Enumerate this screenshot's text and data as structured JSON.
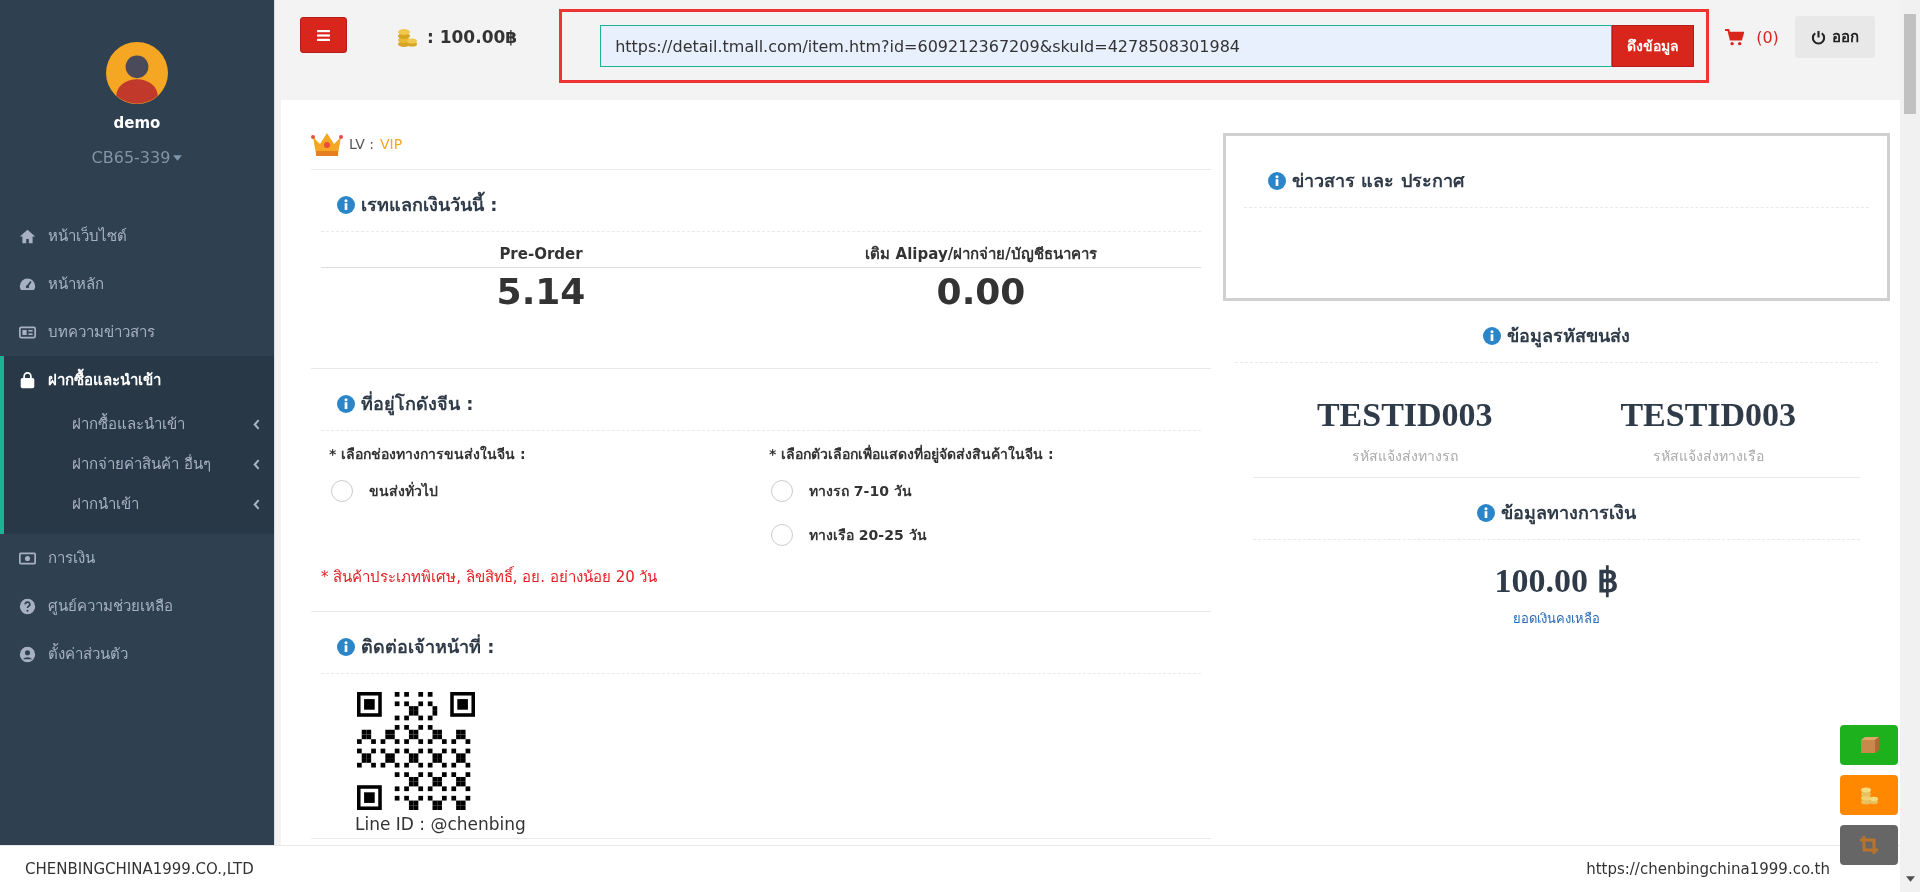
{
  "sidebar": {
    "user": {
      "name": "demo",
      "code": "CB65-339"
    },
    "items": [
      {
        "label": "หน้าเว็บไซต์",
        "selected": false
      },
      {
        "label": "หน้าหลัก",
        "selected": false
      },
      {
        "label": "บทความข่าวสาร",
        "selected": false
      },
      {
        "label": "ฝากซื้อและนำเข้า",
        "selected": true,
        "expanded": true,
        "children": [
          {
            "label": "ฝากซื้อและนำเข้า"
          },
          {
            "label": "ฝากจ่ายค่าสินค้า อื่นๆ"
          },
          {
            "label": "ฝากนำเข้า"
          }
        ]
      },
      {
        "label": "การเงิน",
        "selected": false
      },
      {
        "label": "ศูนย์ความช่วยเหลือ",
        "selected": false
      },
      {
        "label": "ตั้งค่าส่วนตัว",
        "selected": false
      }
    ]
  },
  "topbar": {
    "balance": ": 100.00฿",
    "url_field": {
      "value": "https://detail.tmall.com/item.htm?id=609212367209&skuId=4278508301984"
    },
    "fetch_button": "ดึงข้อมูล",
    "cart_count": "(0)",
    "logout_button": "ออก"
  },
  "level": {
    "label": "LV :",
    "value": "VIP"
  },
  "rates": {
    "title": "เรทแลกเงินวันนี้ :",
    "columns": [
      {
        "label": "Pre-Order",
        "value": "5.14"
      },
      {
        "label": "เติม Alipay/ฝากจ่าย/บัญชีธนาคาร",
        "value": "0.00"
      }
    ]
  },
  "warehouse": {
    "title": "ที่อยู่โกดังจีน :",
    "groups": [
      {
        "label": "* เลือกช่องทางการขนส่งในจีน :",
        "options": [
          {
            "label": "ขนส่งทั่วไป",
            "selected": false
          }
        ]
      },
      {
        "label": "* เลือกตัวเลือกเพื่อแสดงที่อยู่จัดส่งสินค้าในจีน :",
        "options": [
          {
            "label": "ทางรถ 7-10 วัน",
            "selected": false
          },
          {
            "label": "ทางเรือ 20-25 วัน",
            "selected": false
          }
        ]
      }
    ],
    "note": "* สินค้าประเภทพิเศษ, ลิขสิทธิ์, อย. อย่างน้อย 20 วัน"
  },
  "contact": {
    "title": "ติดต่อเจ้าหน้าที่ :",
    "line_id": "Line ID : @chenbing"
  },
  "news": {
    "title": "ข่าวสาร และ ประกาศ"
  },
  "shipping_codes": {
    "title": "ข้อมูลรหัสขนส่ง",
    "codes": [
      {
        "code": "TESTID003",
        "label": "รหัสแจ้งส่งทางรถ"
      },
      {
        "code": "TESTID003",
        "label": "รหัสแจ้งส่งทางเรือ"
      }
    ]
  },
  "finance": {
    "title": "ข้อมูลทางการเงิน",
    "amount": "100.00 ฿",
    "link": "ยอดเงินคงเหลือ"
  },
  "footer": {
    "company": "CHENBINGCHINA1999.CO.,LTD",
    "url": "https://chenbingchina1999.co.th"
  }
}
